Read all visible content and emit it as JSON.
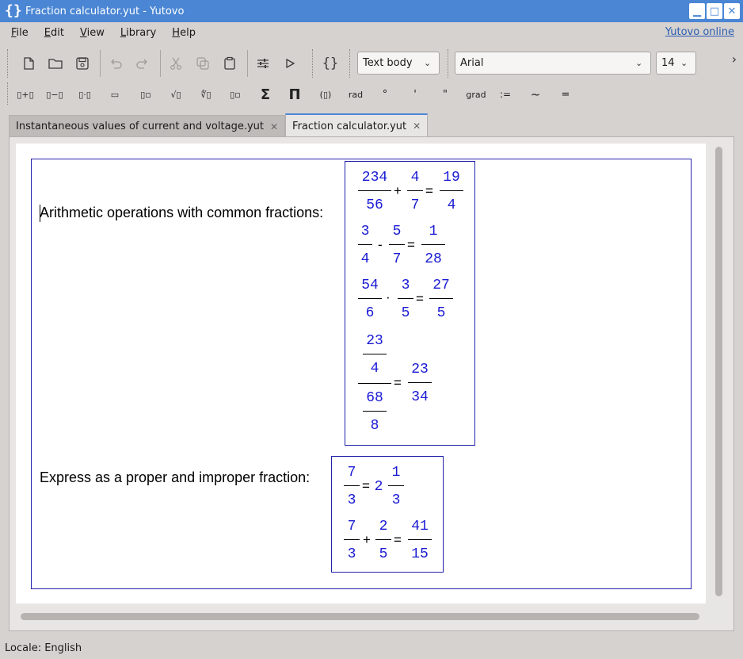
{
  "window": {
    "title": "Fraction calculator.yut - Yutovo"
  },
  "menu": {
    "items": [
      "File",
      "Edit",
      "View",
      "Library",
      "Help"
    ],
    "online_link": "Yutovo online"
  },
  "toolbar": {
    "style_combo": "Text body",
    "font_combo": "Arial",
    "size_combo": "14"
  },
  "toolbar2": {
    "labels": [
      "▯+▯",
      "▯−▯",
      "▯·▯",
      "▭",
      "▯▫",
      "√▯",
      "∜▯",
      "▯▫",
      "Σ",
      "Π",
      "(▯)",
      "rad",
      "°",
      "'",
      "\"",
      "grad",
      ":=",
      "~",
      "="
    ]
  },
  "tabs": [
    {
      "label": "Instantaneous values of current and voltage.yut",
      "active": false
    },
    {
      "label": "Fraction calculator.yut",
      "active": true
    }
  ],
  "document": {
    "line1": "Arithmetic operations with common fractions:",
    "line2": "Express as a proper and improper fraction:",
    "math": {
      "e1": {
        "a_num": "234",
        "a_den": "56",
        "op": "+",
        "b_num": "4",
        "b_den": "7",
        "eq": "=",
        "r_num": "19",
        "r_den": "4"
      },
      "e2": {
        "a_num": "3",
        "a_den": "4",
        "op": "-",
        "b_num": "5",
        "b_den": "7",
        "eq": "=",
        "r_num": "1",
        "r_den": "28"
      },
      "e3": {
        "a_num": "54",
        "a_den": "6",
        "op": "·",
        "b_num": "3",
        "b_den": "5",
        "eq": "=",
        "r_num": "27",
        "r_den": "5"
      },
      "e4": {
        "nn": "23",
        "nd": "4",
        "dn": "68",
        "dd": "8",
        "eq": "=",
        "r_num": "23",
        "r_den": "34"
      },
      "e5": {
        "a_num": "7",
        "a_den": "3",
        "eq": "=",
        "whole": "2",
        "r_num": "1",
        "r_den": "3"
      },
      "e6": {
        "a_num": "7",
        "a_den": "3",
        "op": "+",
        "b_num": "2",
        "b_den": "5",
        "eq": "=",
        "r_num": "41",
        "r_den": "15"
      }
    }
  },
  "status": {
    "locale": "Locale: English"
  },
  "colors": {
    "accent": "#4a86d4",
    "math_blue": "#1a1ad4",
    "frame_blue": "#2222aa"
  }
}
